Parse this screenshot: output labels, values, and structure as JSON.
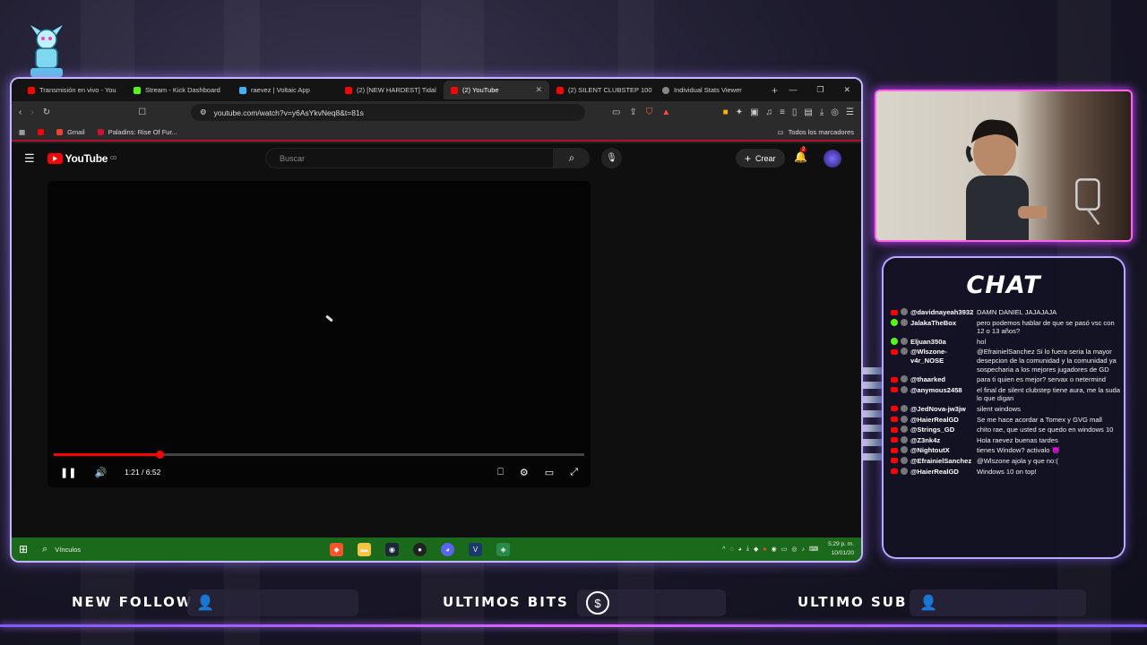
{
  "browser": {
    "tabs": [
      {
        "label": "Transmisión en vivo - You",
        "color": "#ff0000",
        "active": false
      },
      {
        "label": "Stream - Kick Dashboard",
        "color": "#53fc18",
        "active": false
      },
      {
        "label": "raevez | Voltaic App",
        "color": "#3fb0ff",
        "active": false
      },
      {
        "label": "(2) [NEW HARDEST] Tidal",
        "color": "#ff0000",
        "active": false
      },
      {
        "label": "(2) YouTube",
        "color": "#ff0000",
        "active": true
      },
      {
        "label": "(2) SILENT CLUBSTEP 100",
        "color": "#ff0000",
        "active": false
      },
      {
        "label": "Individual Stats Viewer",
        "color": "#cccccc",
        "active": false
      }
    ],
    "url": "youtube.com/watch?v=y6AsYkvNeq8&t=81s",
    "shield_badge": "2",
    "bookmarks": [
      {
        "label": "Gmail",
        "color": "#ea4335"
      },
      {
        "label": "Paladins: Rise Of Fur...",
        "color": "#d01030"
      }
    ],
    "all_bookmarks": "Todos los marcadores"
  },
  "youtube": {
    "logo_text": "YouTube",
    "logo_sup": "CO",
    "search_placeholder": "Buscar",
    "create_label": "Crear",
    "notif_count": "2",
    "time": "1:21 / 6:52",
    "progress": 0.2
  },
  "taskbar": {
    "search_label": "Vínculos",
    "time": "5:29 p. m.",
    "date": "10/01/20"
  },
  "chat": {
    "title": "CHAT",
    "messages": [
      {
        "platform": "youtube",
        "user": "@davidnayeah3932",
        "text": "DAMN DANIEL JAJAJAJA"
      },
      {
        "platform": "kick",
        "user": "JalakaTheBox",
        "text": "pero podemos hablar de que se pasó vsc con 12 o 13 años?"
      },
      {
        "platform": "kick",
        "user": "Eljuan350a",
        "text": "hol"
      },
      {
        "platform": "youtube",
        "user": "@Wlszone-v4r_NOSE",
        "text": "@EfrainielSanchez Si lo fuera seria la mayor desepcion de la comunidad y la comunidad ya sospecharia a los mejores jugadores de GD"
      },
      {
        "platform": "youtube",
        "user": "@thaarked",
        "text": "para ti quien es mejor? servax o netermind"
      },
      {
        "platform": "youtube",
        "user": "@anymous2458",
        "text": "el final de silent clubstep tiene aura, me la suda lo que digan"
      },
      {
        "platform": "youtube",
        "user": "@JedNova-jw3jw",
        "text": "silent windows"
      },
      {
        "platform": "youtube",
        "user": "@HaierRealGD",
        "text": "Se me hace acordar a Tomex y GVG mall"
      },
      {
        "platform": "youtube",
        "user": "@Strings_GD",
        "text": "chito rae, que usted se quedo en windows 10"
      },
      {
        "platform": "youtube",
        "user": "@Z3nk4z",
        "text": "Hola raevez buenas tardes"
      },
      {
        "platform": "youtube",
        "user": "@NightoutX",
        "text": "tienes Window? activalo 😈"
      },
      {
        "platform": "youtube",
        "user": "@EfrainielSanchez",
        "text": "@Wlszone ajola y que no:("
      },
      {
        "platform": "youtube",
        "user": "@HaierRealGD",
        "text": "Windows 10 on top!"
      }
    ]
  },
  "bottom": {
    "follow_label": "NEW FOLLOW",
    "bits_label": "ULTIMOS BITS",
    "sub_label": "ULTIMO SUB",
    "bits_icon": "$"
  },
  "colors": {
    "accent_neon": "#b070ff",
    "youtube_red": "#ff0000",
    "kick_green": "#53fc18",
    "taskbar_green": "#1b6a1b"
  }
}
